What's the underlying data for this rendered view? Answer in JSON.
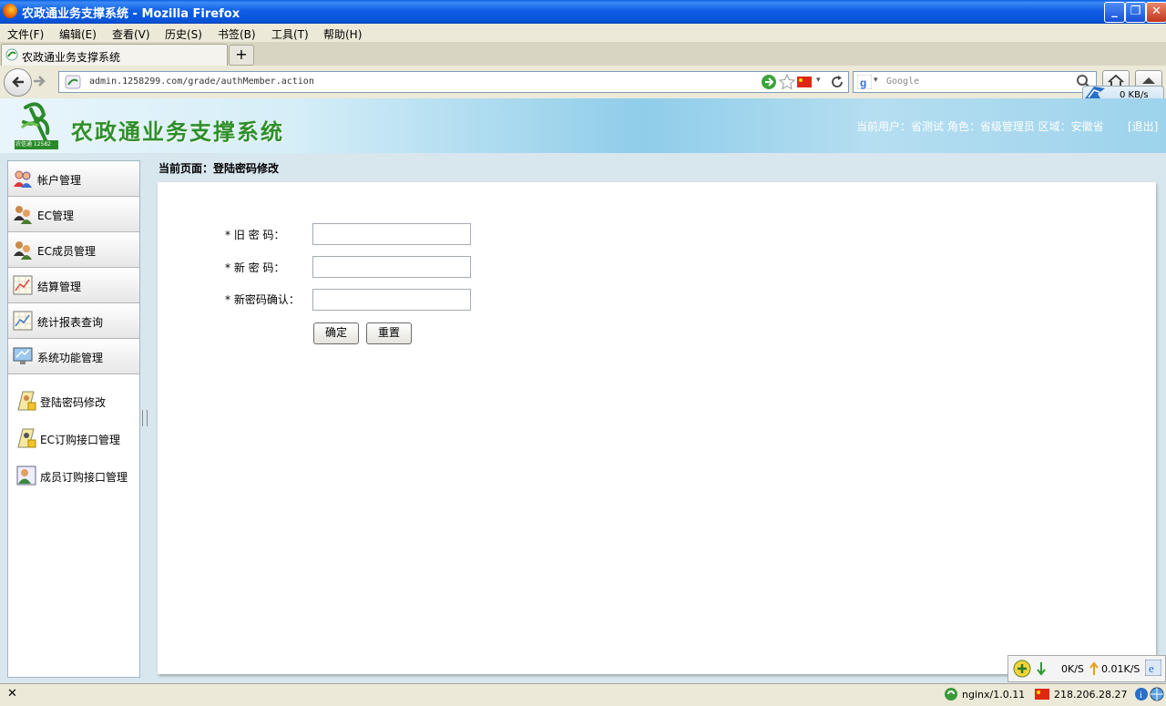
{
  "window": {
    "title": "农政通业务支撑系统 - Mozilla Firefox",
    "min_btn": "_",
    "max_btn": "❐",
    "close_btn": "✕"
  },
  "menubar": {
    "items": [
      "文件(F)",
      "编辑(E)",
      "查看(V)",
      "历史(S)",
      "书签(B)",
      "工具(T)",
      "帮助(H)"
    ]
  },
  "tabs": {
    "active_label": "农政通业务支撑系统",
    "new_tab": "+"
  },
  "nav": {
    "url": "admin.1258299.com/grade/authMember.action",
    "search_placeholder": "Google",
    "speed": "0 KB/s"
  },
  "header": {
    "logo_text": "农信通 12582",
    "title": "农政通业务支撑系统",
    "user_info": "当前用户：省测试  角色：省级管理员 区域：安徽省",
    "logout": "[退出]"
  },
  "sidebar": {
    "menu": [
      {
        "label": "帐户管理",
        "icon": "users-icon"
      },
      {
        "label": "EC管理",
        "icon": "group-icon"
      },
      {
        "label": "EC成员管理",
        "icon": "group-icon"
      },
      {
        "label": "结算管理",
        "icon": "chart-icon"
      },
      {
        "label": "统计报表查询",
        "icon": "chart-icon"
      },
      {
        "label": "系统功能管理",
        "icon": "monitor-icon"
      }
    ],
    "submenu": [
      {
        "label": "登陆密码修改",
        "icon": "lock-user-icon"
      },
      {
        "label": "EC订购接口管理",
        "icon": "lock-user-icon"
      },
      {
        "label": "成员订购接口管理",
        "icon": "user-card-icon"
      }
    ]
  },
  "page": {
    "breadcrumb": "当前页面：登陆密码修改",
    "form": {
      "old_password_label": "* 旧  密  码：",
      "new_password_label": "* 新  密  码：",
      "confirm_label": "* 新密码确认：",
      "submit": "确定",
      "reset": "重置"
    }
  },
  "statusbar": {
    "close": "✕",
    "server": "nginx/1.0.11",
    "ip": "218.206.28.27",
    "down": "0K/S",
    "up": "0.01K/S"
  }
}
